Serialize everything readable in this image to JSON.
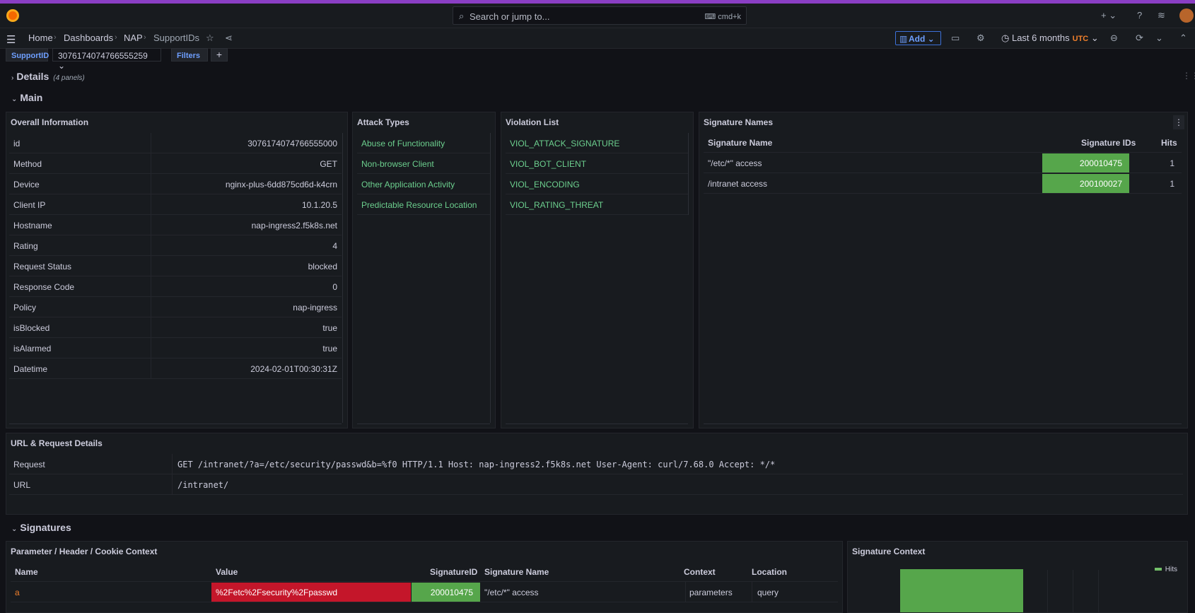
{
  "topbar": {
    "search_placeholder": "Search or jump to...",
    "search_shortcut": "cmd+k"
  },
  "breadcrumb": {
    "items": [
      "Home",
      "Dashboards",
      "NAP",
      "SupportIDs"
    ]
  },
  "toolbar": {
    "add_label": "Add",
    "time_range": "Last 6 months",
    "timezone": "UTC"
  },
  "variables": {
    "supportid_label": "SupportID",
    "supportid_value": "3076174074766555259",
    "filters_label": "Filters",
    "add_filter": "+"
  },
  "rows": {
    "details": {
      "title": "Details",
      "count": "(4 panels)"
    },
    "main": {
      "title": "Main"
    },
    "signatures": {
      "title": "Signatures"
    }
  },
  "overall": {
    "title": "Overall Information",
    "rows": [
      {
        "key": "id",
        "value": "3076174074766555000"
      },
      {
        "key": "Method",
        "value": "GET"
      },
      {
        "key": "Device",
        "value": "nginx-plus-6dd875cd6d-k4crn"
      },
      {
        "key": "Client IP",
        "value": "10.1.20.5"
      },
      {
        "key": "Hostname",
        "value": "nap-ingress2.f5k8s.net"
      },
      {
        "key": "Rating",
        "value": "4"
      },
      {
        "key": "Request Status",
        "value": "blocked"
      },
      {
        "key": "Response Code",
        "value": "0"
      },
      {
        "key": "Policy",
        "value": "nap-ingress"
      },
      {
        "key": "isBlocked",
        "value": "true"
      },
      {
        "key": "isAlarmed",
        "value": "true"
      },
      {
        "key": "Datetime",
        "value": "2024-02-01T00:30:31Z"
      }
    ]
  },
  "attack_types": {
    "title": "Attack Types",
    "items": [
      "Abuse of Functionality",
      "Non-browser Client",
      "Other Application Activity",
      "Predictable Resource Location"
    ]
  },
  "violations": {
    "title": "Violation List",
    "items": [
      "VIOL_ATTACK_SIGNATURE",
      "VIOL_BOT_CLIENT",
      "VIOL_ENCODING",
      "VIOL_RATING_THREAT"
    ]
  },
  "signature_names": {
    "title": "Signature Names",
    "headers": [
      "Signature Name",
      "Signature IDs",
      "Hits"
    ],
    "rows": [
      {
        "name": "\"/etc/*\" access",
        "id": "200010475",
        "hits": "1"
      },
      {
        "name": "/intranet access",
        "id": "200100027",
        "hits": "1"
      }
    ]
  },
  "url_details": {
    "title": "URL & Request Details",
    "rows": [
      {
        "key": "Request",
        "value": "GET /intranet/?a=/etc/security/passwd&b=%f0 HTTP/1.1 Host: nap-ingress2.f5k8s.net User-Agent: curl/7.68.0 Accept: */*"
      },
      {
        "key": "URL",
        "value": "/intranet/"
      }
    ]
  },
  "param_context": {
    "title": "Parameter / Header / Cookie Context",
    "headers": [
      "Name",
      "Value",
      "SignatureID",
      "Signature Name",
      "Context",
      "Location"
    ],
    "rows": [
      {
        "name": "a",
        "value": "%2Fetc%2Fsecurity%2Fpasswd",
        "sigid": "200010475",
        "signame": "\"/etc/*\" access",
        "context": "parameters",
        "location": "query"
      }
    ]
  },
  "signature_context": {
    "title": "Signature Context",
    "legend": "Hits"
  },
  "colors": {
    "accent": "#8a3ec4",
    "link_green": "#6ccf8e",
    "cell_green": "#56a64b",
    "cell_red": "#c4162a",
    "primary_blue": "#6e9fff"
  }
}
